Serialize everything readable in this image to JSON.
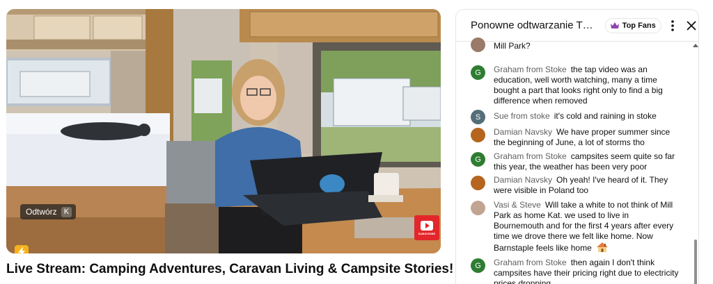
{
  "player": {
    "play_hint": "Odtwórz",
    "play_key": "K",
    "subscribe_text": "SUBSCRIBE"
  },
  "video": {
    "title": "Live Stream: Camping Adventures, Caravan Living & Campsite Stories!"
  },
  "chat": {
    "title": "Ponowne odtwarzanie T…",
    "filter_label": "Top Fans",
    "messages": [
      {
        "author": "",
        "text": "Mill Park?",
        "avatar_color": "#9a7a6a",
        "avatar_initial": ""
      },
      {
        "author": "Graham from Stoke",
        "text": "the tap video was an education, well worth watching, many a time bought a part that looks right only to find a big difference when removed",
        "avatar_color": "#2e7d32",
        "avatar_initial": "G"
      },
      {
        "author": "Sue from stoke",
        "text": "it's cold and raining in stoke",
        "avatar_color": "#546e7a",
        "avatar_initial": "S"
      },
      {
        "author": "Damian Navsky",
        "text": "We have proper summer since the beginning of June, a lot of storms tho",
        "avatar_color": "#b5651d",
        "avatar_initial": ""
      },
      {
        "author": "Graham from Stoke",
        "text": "campsites seem quite so far this year, the weather has been very poor",
        "avatar_color": "#2e7d32",
        "avatar_initial": "G"
      },
      {
        "author": "Damian Navsky",
        "text": "Oh yeah! I've heard of it. They were visible in Poland too",
        "avatar_color": "#b5651d",
        "avatar_initial": ""
      },
      {
        "author": "Vasi & Steve",
        "text": "Will take a white to not think of Mill Park as home Kat. we used to live in Bournemouth and for the first 4 years after every time we drove there we felt like home. Now Barnstaple feels like home",
        "avatar_color": "#c2a493",
        "avatar_initial": ""
      },
      {
        "author": "Graham from Stoke",
        "text": "then again I don't think campsites have their pricing right due to electricity prices dropping",
        "avatar_color": "#2e7d32",
        "avatar_initial": "G"
      }
    ]
  },
  "colors": {
    "subscribe_red": "#e3262b",
    "author_gray": "#606060",
    "fans_purple": "#8e44ad"
  }
}
